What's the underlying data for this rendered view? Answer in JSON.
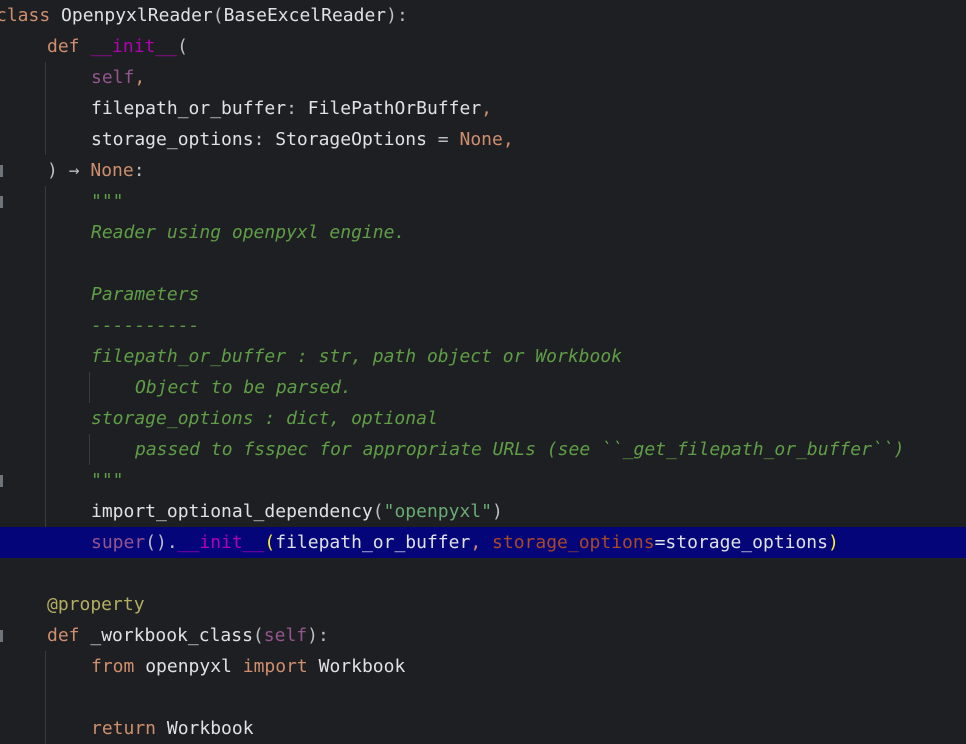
{
  "code": {
    "l1": [
      "class",
      " ",
      "OpenpyxlReader",
      "(",
      "BaseExcelReader",
      "):"
    ],
    "l2": [
      "def",
      " ",
      "__init__",
      "("
    ],
    "l3": [
      "self",
      ","
    ],
    "l4": [
      "filepath_or_buffer",
      ": ",
      "FilePathOrBuffer",
      ","
    ],
    "l5": [
      "storage_options",
      ": ",
      "StorageOptions",
      " = ",
      "None",
      ","
    ],
    "l6": [
      ") ",
      "→",
      " ",
      "None",
      ":"
    ],
    "l7": "\"\"\"",
    "l8": "Reader using openpyxl engine.",
    "l10": "Parameters",
    "l11": "----------",
    "l12": "filepath_or_buffer : str, path object or Workbook",
    "l13": "Object to be parsed.",
    "l14": "storage_options : dict, optional",
    "l15": "passed to fsspec for appropriate URLs (see ``_get_filepath_or_buffer``)",
    "l16": "\"\"\"",
    "l17": [
      "import_optional_dependency",
      "(",
      "\"openpyxl\"",
      ")"
    ],
    "l18": [
      "super",
      "().",
      "__init__",
      "(",
      "filepath_or_buffer",
      ", ",
      "storage_options",
      "=",
      "storage_options",
      ")"
    ],
    "l20": "@property",
    "l21": [
      "def",
      " ",
      "_workbook_class",
      "(",
      "self",
      "):"
    ],
    "l22": [
      "from",
      " ",
      "openpyxl",
      " ",
      "import",
      " ",
      "Workbook"
    ],
    "l24": [
      "return",
      " ",
      "Workbook"
    ]
  },
  "colors": {
    "background": "#1e1f22",
    "highlight_line": "#05057a",
    "keyword": "#cf8e6d",
    "docstring": "#5f9e46",
    "dunder": "#b200b2",
    "self": "#94558d",
    "decorator": "#b3ae60"
  }
}
